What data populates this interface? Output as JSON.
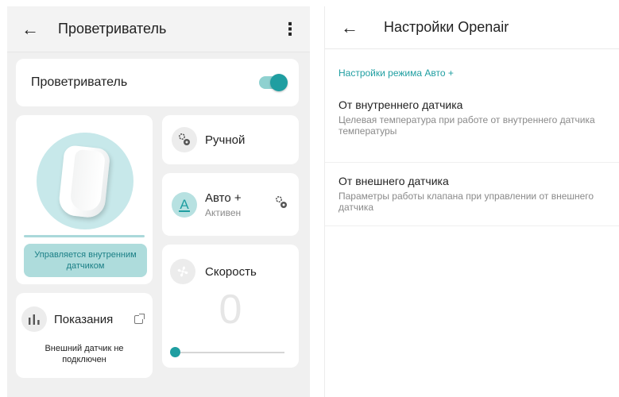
{
  "left": {
    "header": {
      "title": "Проветриватель",
      "back_icon": "arrow-left-icon",
      "menu_icon": "more-vert-icon"
    },
    "main_toggle": {
      "label": "Проветриватель",
      "on": true
    },
    "device": {
      "control_badge": "Управляется внутренним датчиком"
    },
    "readings": {
      "label": "Показания",
      "message": "Внешний датчик не подключен"
    },
    "modes": {
      "manual": {
        "label": "Ручной"
      },
      "auto": {
        "letter": "A",
        "label": "Авто +",
        "status": "Активен"
      }
    },
    "speed": {
      "label": "Скорость",
      "value": "0",
      "slider_fraction": 0
    }
  },
  "right": {
    "header": {
      "title": "Настройки Openair",
      "back_icon": "arrow-left-icon"
    },
    "section_title": "Настройки режима Авто +",
    "items": [
      {
        "title": "От внутреннего датчика",
        "description": "Целевая температура при работе от внутреннего датчика температуры"
      },
      {
        "title": "От внешнего датчика",
        "description": "Параметры работы клапана при управлении от внешнего датчика"
      }
    ]
  },
  "colors": {
    "accent": "#1f9ea1",
    "accent_light": "#aedcdc",
    "background": "#f0f0f0"
  }
}
